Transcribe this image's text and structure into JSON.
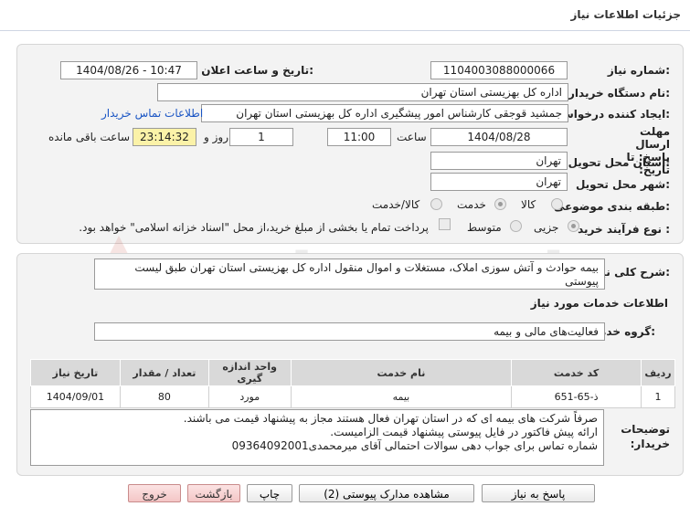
{
  "header": {
    "title": "جزئیات اطلاعات نیاز"
  },
  "labels": {
    "need_number": "شماره نیاز:",
    "announce_datetime": "تاریخ و ساعت اعلان عمومی:",
    "buyer_org": "نام دستگاه خریدار:",
    "requester": "ایجاد کننده درخواست:",
    "contact_link": "اطلاعات تماس خریدار",
    "deadline": "مهلت ارسال پاسخ: تا تاریخ:",
    "time_word": "ساعت",
    "day_and": "روز و",
    "remaining": "ساعت باقی مانده",
    "province": "استان محل تحویل:",
    "city": "شهر محل تحویل:",
    "category": "طبقه بندی موضوعی:",
    "process_type": "نوع فرآیند خرید :",
    "general_desc": "شرح کلی نیاز:",
    "services_info": "اطلاعات خدمات مورد نیاز",
    "service_group": "گروه خدمت:",
    "buyer_notes": "توضیحات خریدار:"
  },
  "values": {
    "need_number": "1104003088000066",
    "announce_datetime": "1404/08/26 - 10:47",
    "buyer_org": "اداره کل بهزیستی استان تهران",
    "requester": "جمشید قوجقی کارشناس امور پیشگیری اداره کل بهزیستی استان تهران",
    "deadline_date": "1404/08/28",
    "deadline_time": "11:00",
    "days": "1",
    "remaining_time": "23:14:32",
    "province": "تهران",
    "city": "تهران",
    "general_desc_line1": "بیمه حوادث و آتش سوزی املاک، مستغلات و اموال منقول اداره کل بهزیستی استان تهران طبق لیست",
    "general_desc_line2": "پیوستی",
    "service_group": "فعالیت‌های مالی و بیمه",
    "buyer_notes_line1": "صرفاً شرکت های بیمه ای که در استان تهران فعال هستند مجاز به پیشنهاد قیمت می باشند.",
    "buyer_notes_line2": "ارائه پیش فاکتور در فایل پیوستی پیشنهاد قیمت الزامیست.",
    "buyer_notes_line3": "شماره تماس برای جواب دهی سوالات احتمالی آقای میرمحمدی09364092001"
  },
  "category_options": {
    "goods": "کالا",
    "service": "خدمت",
    "goods_service": "کالا/خدمت",
    "selected": "خدمت"
  },
  "process_options": {
    "minor": "جزیی",
    "medium": "متوسط",
    "treasury_note": "پرداخت تمام یا بخشی از مبلغ خرید،از محل \"اسناد خزانه اسلامی\" خواهد بود.",
    "selected": "جزیی"
  },
  "table": {
    "headers": [
      "ردیف",
      "کد خدمت",
      "نام خدمت",
      "واحد اندازه گیری",
      "تعداد / مقدار",
      "تاریخ نیاز"
    ],
    "row": [
      "1",
      "ذ-65-651",
      "بیمه",
      "مورد",
      "80",
      "1404/09/01"
    ]
  },
  "buttons": {
    "reply": "پاسخ به نیاز",
    "attachments": "مشاهده مدارک پیوستی (2)",
    "print": "چاپ",
    "back": "بازگشت",
    "exit": "خروج"
  },
  "watermark": {
    "text": "AriaTender.net"
  },
  "colors": {
    "accent_red": "#c0392b",
    "link_blue": "#1a55c4",
    "highlight_yellow": "#fbf2a8"
  }
}
